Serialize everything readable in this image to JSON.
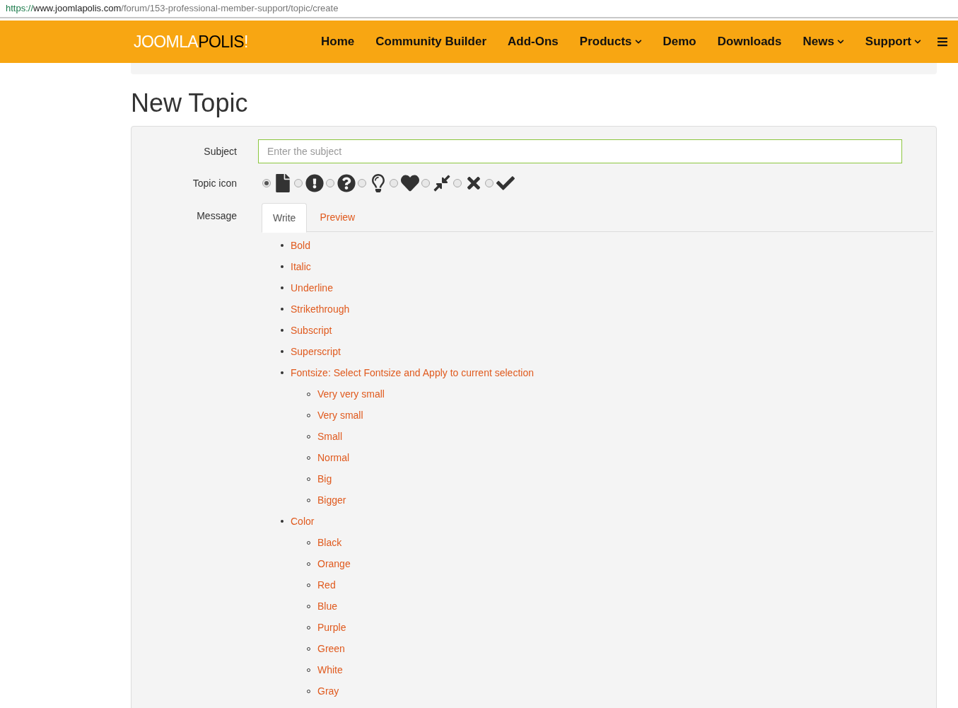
{
  "address_bar": {
    "scheme": "https://",
    "host": "www.joomlapolis.com",
    "path": "/forum/153-professional-member-support/topic/create"
  },
  "navbar": {
    "logo": {
      "light": "JOOMLA",
      "dark": "POLIS",
      "mark": "!"
    },
    "items": [
      {
        "label": "Home",
        "dropdown": false
      },
      {
        "label": "Community Builder",
        "dropdown": false
      },
      {
        "label": "Add-Ons",
        "dropdown": false
      },
      {
        "label": "Products",
        "dropdown": true
      },
      {
        "label": "Demo",
        "dropdown": false
      },
      {
        "label": "Downloads",
        "dropdown": false
      },
      {
        "label": "News",
        "dropdown": true
      },
      {
        "label": "Support",
        "dropdown": true
      }
    ]
  },
  "page_title": "New Topic",
  "form": {
    "subject": {
      "label": "Subject",
      "placeholder": "Enter the subject"
    },
    "topic_icon": {
      "label": "Topic icon",
      "options": [
        {
          "selected": true
        },
        {
          "selected": false
        },
        {
          "selected": false
        },
        {
          "selected": false
        },
        {
          "selected": false
        },
        {
          "selected": false
        },
        {
          "selected": false
        },
        {
          "selected": false
        }
      ]
    },
    "message": {
      "label": "Message",
      "tabs": [
        {
          "label": "Write",
          "selected": true
        },
        {
          "label": "Preview",
          "selected": false
        }
      ],
      "toolbar": [
        {
          "label": "Bold"
        },
        {
          "label": "Italic"
        },
        {
          "label": "Underline"
        },
        {
          "label": "Strikethrough"
        },
        {
          "label": "Subscript"
        },
        {
          "label": "Superscript"
        },
        {
          "label": "Fontsize: Select Fontsize and Apply to current selection",
          "children": [
            {
              "label": "Very very small"
            },
            {
              "label": "Very small"
            },
            {
              "label": "Small"
            },
            {
              "label": "Normal"
            },
            {
              "label": "Big"
            },
            {
              "label": "Bigger"
            }
          ]
        },
        {
          "label": "Color",
          "children": [
            {
              "label": "Black"
            },
            {
              "label": "Orange"
            },
            {
              "label": "Red"
            },
            {
              "label": "Blue"
            },
            {
              "label": "Purple"
            },
            {
              "label": "Green"
            },
            {
              "label": "White"
            },
            {
              "label": "Gray"
            }
          ]
        }
      ]
    }
  }
}
